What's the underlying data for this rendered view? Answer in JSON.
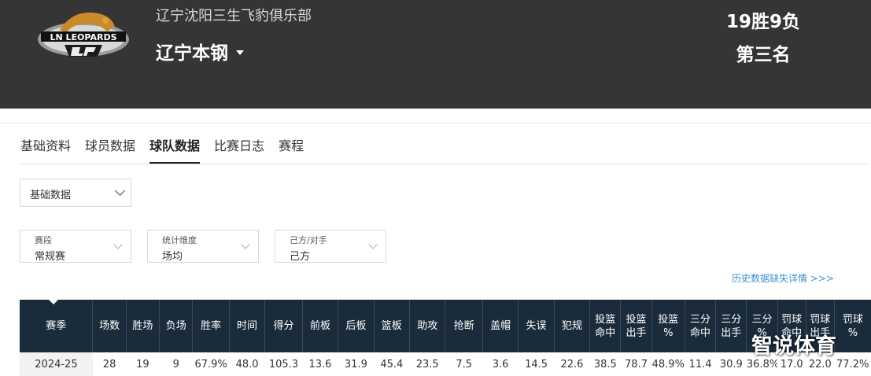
{
  "header": {
    "logo_text": "LN LEOPARDS",
    "club_name": "辽宁沈阳三生飞豹俱乐部",
    "team_name": "辽宁本钢",
    "record": "19胜9负",
    "rank": "第三名"
  },
  "tabs": [
    {
      "label": "基础资料",
      "active": false
    },
    {
      "label": "球员数据",
      "active": false
    },
    {
      "label": "球队数据",
      "active": true
    },
    {
      "label": "比赛日志",
      "active": false
    },
    {
      "label": "赛程",
      "active": false
    }
  ],
  "main_select": {
    "value": "基础数据"
  },
  "filters": {
    "season_type": {
      "label": "赛段",
      "value": "常规赛"
    },
    "stat_dimension": {
      "label": "统计维度",
      "value": "场均"
    },
    "side": {
      "label": "己方/对手",
      "value": "己方"
    }
  },
  "history_link": "历史数据缺失详情 >>>",
  "table": {
    "headers": [
      "赛季",
      "场数",
      "胜场",
      "负场",
      "胜率",
      "时间",
      "得分",
      "前板",
      "后板",
      "篮板",
      "助攻",
      "抢断",
      "盖帽",
      "失误",
      "犯规",
      "投篮\n命中",
      "投篮\n出手",
      "投篮\n%",
      "三分\n命中",
      "三分\n出手",
      "三分\n%",
      "罚球\n命中",
      "罚球\n出手",
      "罚球\n%"
    ],
    "rows": [
      [
        "2024-25",
        "28",
        "19",
        "9",
        "67.9%",
        "48.0",
        "105.3",
        "13.6",
        "31.9",
        "45.4",
        "23.5",
        "7.5",
        "3.6",
        "14.5",
        "22.6",
        "38.5",
        "78.7",
        "48.9%",
        "11.4",
        "30.9",
        "36.8%",
        "17.0",
        "22.0",
        "77.2%"
      ]
    ]
  },
  "watermark": "智说体育",
  "colors": {
    "header_bg": "#353535",
    "table_header_bg": "#1a2c3c",
    "link": "#3a8fd6"
  }
}
